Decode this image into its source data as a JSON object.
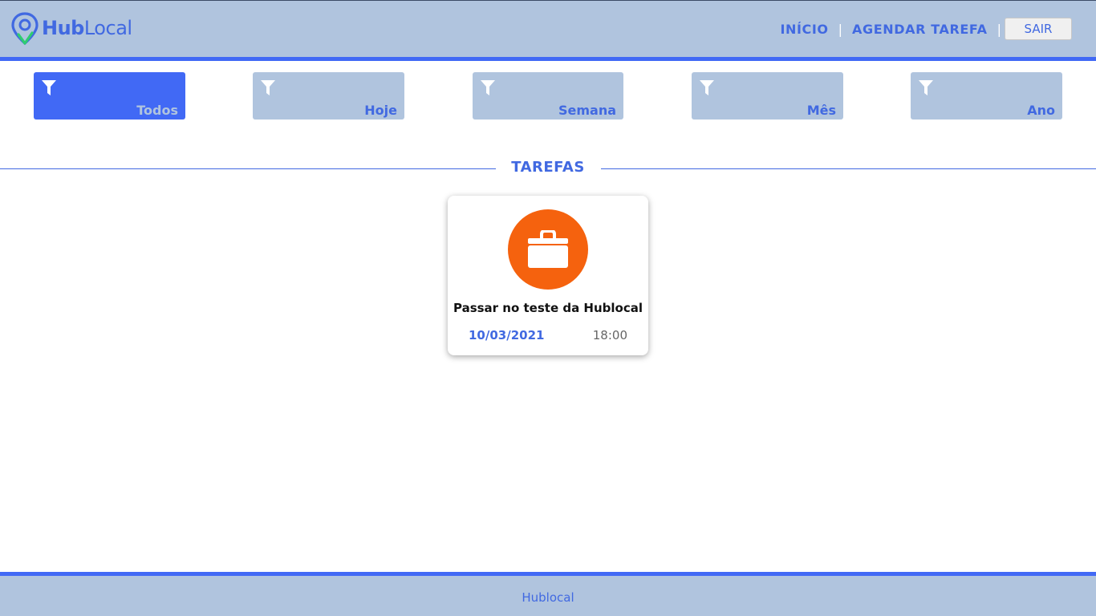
{
  "brand": {
    "hub": "Hub",
    "local": "Local"
  },
  "nav": {
    "home_label": "INÍCIO",
    "separator": "|",
    "schedule_label": "AGENDAR TAREFA",
    "logout_label": "SAIR"
  },
  "filters": [
    {
      "label": "Todos",
      "active": true,
      "icon": "filter-icon"
    },
    {
      "label": "Hoje",
      "active": false,
      "icon": "filter-icon"
    },
    {
      "label": "Semana",
      "active": false,
      "icon": "filter-icon"
    },
    {
      "label": "Mês",
      "active": false,
      "icon": "filter-icon"
    },
    {
      "label": "Ano",
      "active": false,
      "icon": "filter-icon"
    }
  ],
  "section": {
    "title": "TAREFAS"
  },
  "tasks": [
    {
      "title": "Passar no teste da Hublocal",
      "date": "10/03/2021",
      "time": "18:00",
      "icon": "briefcase-icon",
      "icon_color": "#f5620e"
    }
  ],
  "footer": {
    "text": "Hublocal"
  },
  "colors": {
    "primary": "#4169e1",
    "accent_bar": "#4169f5",
    "header_bg": "#b0c4de",
    "logo_green": "#2ecc71"
  }
}
